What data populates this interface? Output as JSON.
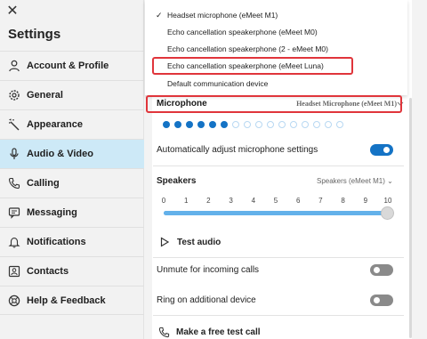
{
  "sidebar": {
    "title": "Settings",
    "items": [
      {
        "label": "Account & Profile",
        "icon": "person-icon"
      },
      {
        "label": "General",
        "icon": "gear-icon"
      },
      {
        "label": "Appearance",
        "icon": "magic-wand-icon"
      },
      {
        "label": "Audio & Video",
        "icon": "microphone-icon"
      },
      {
        "label": "Calling",
        "icon": "phone-icon"
      },
      {
        "label": "Messaging",
        "icon": "message-icon"
      },
      {
        "label": "Notifications",
        "icon": "bell-icon"
      },
      {
        "label": "Contacts",
        "icon": "contacts-icon"
      },
      {
        "label": "Help & Feedback",
        "icon": "help-icon"
      }
    ],
    "active_index": 3
  },
  "dropdown": {
    "selected_check": "✓",
    "options": [
      "Headset microphone (eMeet M1)",
      "Echo cancellation speakerphone (eMeet M0)",
      "Echo cancellation speakerphone (2 - eMeet M0)",
      "Echo cancellation speakerphone (eMeet Luna)",
      "Default communication device"
    ],
    "selected_index": 0,
    "highlighted_index": 3
  },
  "microphone": {
    "title": "Microphone",
    "device": "Headset Microphone (eMeet M1)",
    "level_dots_total": 16,
    "level_dots_active": 6,
    "auto_adjust_label": "Automatically adjust microphone settings",
    "auto_adjust_on": true
  },
  "speakers": {
    "title": "Speakers",
    "device": "Speakers (eMeet M1)",
    "scale": [
      "0",
      "1",
      "2",
      "3",
      "4",
      "5",
      "6",
      "7",
      "8",
      "9",
      "10"
    ],
    "volume": 10,
    "test_audio_label": "Test audio"
  },
  "toggles": [
    {
      "label": "Unmute for incoming calls",
      "on": false
    },
    {
      "label": "Ring on additional device",
      "on": false
    }
  ],
  "free_call_label": "Make a free test call",
  "colors": {
    "accent": "#1473c5",
    "active_nav_bg": "#cde9f7",
    "highlight_red": "#e0353b"
  }
}
